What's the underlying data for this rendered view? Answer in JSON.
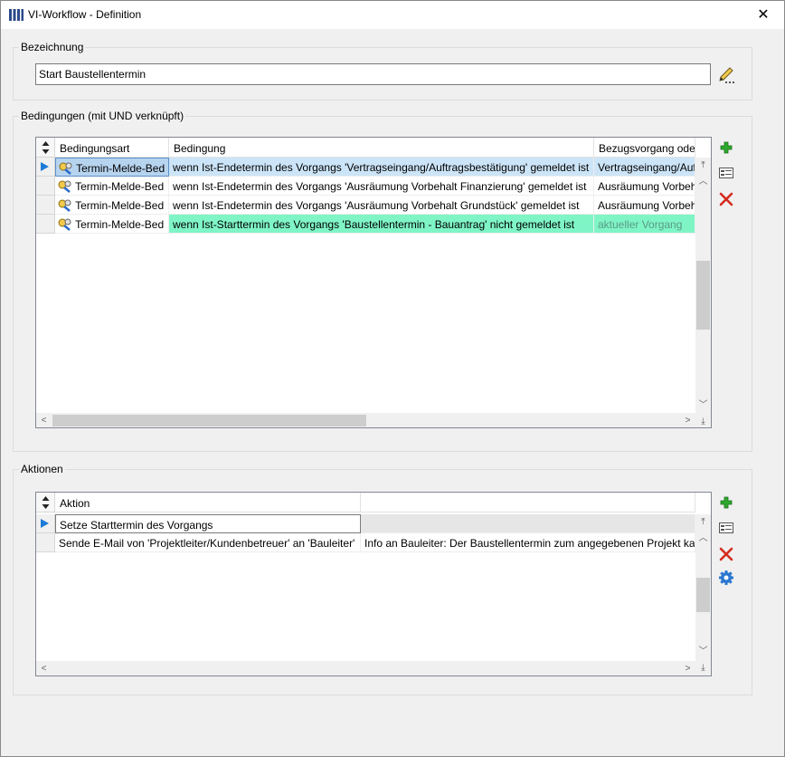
{
  "window": {
    "title": "VI-Workflow - Definition",
    "close_glyph": "✕"
  },
  "bezeichnung": {
    "group_label": "Bezeichnung",
    "value": "Start Baustellentermin"
  },
  "bedingungen": {
    "group_label": "Bedingungen (mit UND verknüpft)",
    "columns": [
      "Bedingungsart",
      "Bedingung",
      "Bezugsvorgang oder Pr"
    ],
    "rows": [
      {
        "art": "Termin-Melde-Bed",
        "bedingung": "wenn Ist-Endetermin des Vorgangs 'Vertragseingang/Auftragsbestätigung' gemeldet ist",
        "bezug": "Vertragseingang/Auft",
        "state": "current"
      },
      {
        "art": "Termin-Melde-Bed",
        "bedingung": "wenn Ist-Endetermin des Vorgangs 'Ausräumung Vorbehalt Finanzierung' gemeldet ist",
        "bezug": "Ausräumung Vorbeh",
        "state": "normal"
      },
      {
        "art": "Termin-Melde-Bed",
        "bedingung": "wenn Ist-Endetermin des Vorgangs 'Ausräumung Vorbehalt Grundstück' gemeldet ist",
        "bezug": "Ausräumung Vorbeh",
        "state": "normal"
      },
      {
        "art": "Termin-Melde-Bed",
        "bedingung": "wenn Ist-Starttermin des Vorgangs 'Baustellentermin - Bauantrag' nicht gemeldet ist",
        "bezug": "aktueller Vorgang",
        "state": "highlight"
      }
    ]
  },
  "aktionen": {
    "group_label": "Aktionen",
    "columns": [
      "Aktion",
      ""
    ],
    "rows": [
      {
        "aktion": "Setze Starttermin des Vorgangs",
        "info": "",
        "state": "current"
      },
      {
        "aktion": "Sende E-Mail von 'Projektleiter/Kundenbetreuer' an 'Bauleiter'",
        "info": "Info an Bauleiter: Der Baustellentermin zum angegebenen Projekt kar",
        "state": "normal"
      }
    ]
  },
  "scroll_glyphs": {
    "up": "︿",
    "down": "﹀",
    "left": "<",
    "right": ">",
    "top": "⤒",
    "bottom": "⤓"
  },
  "icons": {
    "title": "app-grid-icon",
    "pencil": "pencil-icon",
    "add": "plus-icon",
    "edit": "edit-record-icon",
    "delete": "delete-x-icon",
    "settings": "gear-icon",
    "condition": "key-condition-icon",
    "current_row": "current-row-arrow-icon",
    "sort": "sort-updown-icon"
  },
  "colors": {
    "selection_blue": "#cce4f7",
    "highlight_green": "#7ff5c6",
    "current_cell": "#b7d4ef",
    "add_green": "#2ea82e",
    "delete_red": "#d42b1e",
    "gear_blue": "#2b77d0"
  }
}
